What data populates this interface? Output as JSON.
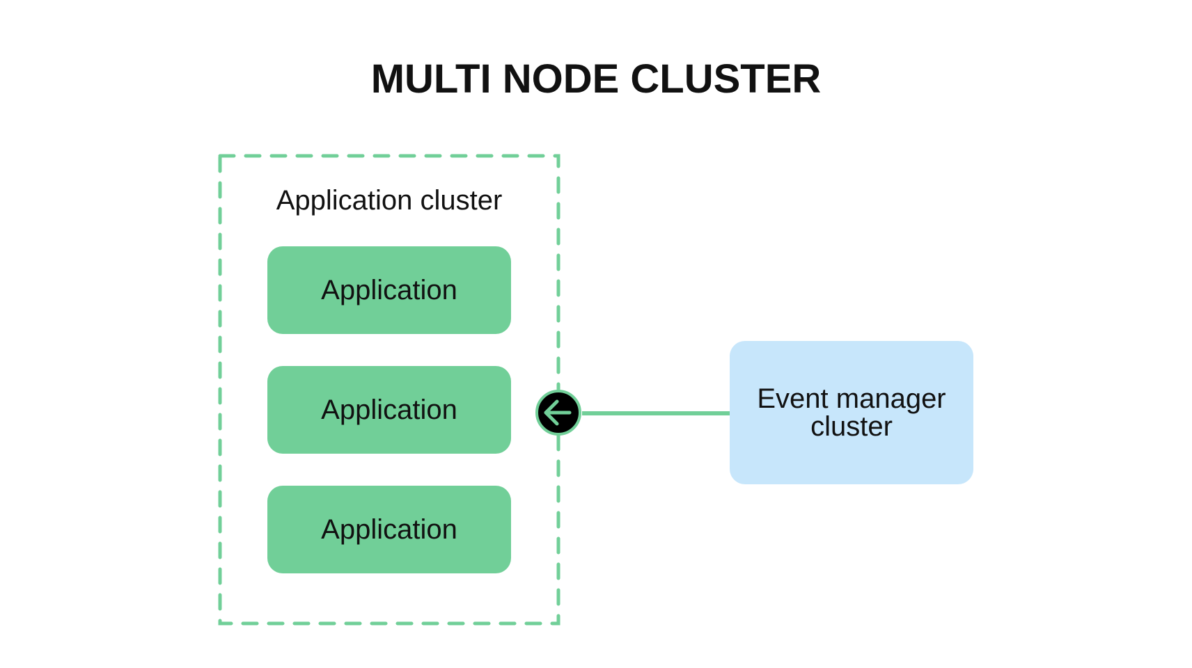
{
  "title": "MULTI NODE CLUSTER",
  "application_cluster": {
    "label": "Application cluster",
    "nodes": [
      {
        "label": "Application"
      },
      {
        "label": "Application"
      },
      {
        "label": "Application"
      }
    ]
  },
  "event_manager": {
    "line1": "Event manager",
    "line2": "cluster"
  },
  "connector": {
    "icon": "arrow-left-icon",
    "direction": "event manager to application cluster"
  },
  "colors": {
    "green": "#71cf98",
    "blue": "#c7e6fb",
    "text": "#111111",
    "node_fill": "#000000"
  }
}
